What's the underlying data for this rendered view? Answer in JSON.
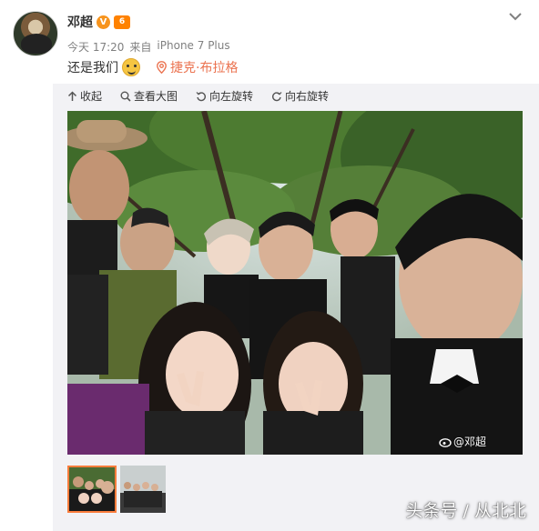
{
  "post": {
    "username": "邓超",
    "verified_badge": "V",
    "vip_badge": "6",
    "timestamp": "今天 17:20",
    "source_prefix": "来自",
    "source": "iPhone 7 Plus",
    "text": "还是我们",
    "emoji": "doge-emoji",
    "location": "捷克·布拉格",
    "accent_color": "#eb7350"
  },
  "toolbar": {
    "collect": "收起",
    "view_large": "查看大图",
    "rotate_left": "向左旋转",
    "rotate_right": "向右旋转"
  },
  "photo": {
    "watermark": "@邓超"
  },
  "thumbnails": [
    {
      "label": "thumbnail-1",
      "selected": true
    },
    {
      "label": "thumbnail-2",
      "selected": false
    }
  ],
  "footer_watermark": "头条号 / 从北北"
}
